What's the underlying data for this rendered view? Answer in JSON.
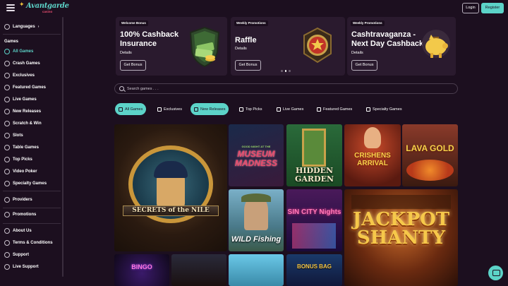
{
  "header": {
    "logo_text": "Avantgarde",
    "logo_sub": "casino",
    "login_label": "Login",
    "register_label": "Register"
  },
  "sidebar": {
    "language_label": "Languages",
    "games_heading": "Games",
    "items": [
      {
        "label": "All Games",
        "icon": "horseshoe-icon",
        "active": true
      },
      {
        "label": "Crash Games",
        "icon": "crash-icon"
      },
      {
        "label": "Exclusives",
        "icon": "exclusive-icon"
      },
      {
        "label": "Featured Games",
        "icon": "star-icon"
      },
      {
        "label": "Live Games",
        "icon": "live-icon"
      },
      {
        "label": "New Releases",
        "icon": "new-icon"
      },
      {
        "label": "Scratch & Win",
        "icon": "scratch-icon"
      },
      {
        "label": "Slots",
        "icon": "slots-icon"
      },
      {
        "label": "Table Games",
        "icon": "table-icon"
      },
      {
        "label": "Top Picks",
        "icon": "top-picks-icon"
      },
      {
        "label": "Video Poker",
        "icon": "poker-icon"
      },
      {
        "label": "Specialty Games",
        "icon": "specialty-icon"
      }
    ],
    "providers_label": "Providers",
    "promotions_label": "Promotions",
    "about_label": "About Us",
    "terms_label": "Terms & Conditions",
    "support_label": "Support",
    "live_support_label": "Live Support"
  },
  "promos": [
    {
      "badge": "Welcome Bonus",
      "title": "100% Cashback Insurance",
      "details": "Details",
      "button": "Get Bonus",
      "icon": "money-shield-icon"
    },
    {
      "badge": "Weekly Promotions",
      "title": "Raffle",
      "details": "Details",
      "button": "Get Bonus",
      "icon": "raffle-chip-icon"
    },
    {
      "badge": "Weekly Promotions",
      "title": "Cashtravaganza - Next Day Cashback",
      "details": "Details",
      "button": "Get Bonus",
      "icon": "piggy-bank-icon"
    }
  ],
  "carousel": {
    "pages": 3,
    "active": 2
  },
  "search": {
    "placeholder": "Search games . . ."
  },
  "categories": [
    {
      "label": "All Games",
      "icon": "horseshoe-icon",
      "active": true
    },
    {
      "label": "Exclusives",
      "icon": "exclusive-icon"
    },
    {
      "label": "New Releases",
      "icon": "new-icon",
      "active": true
    },
    {
      "label": "Top Picks",
      "icon": "top-picks-icon"
    },
    {
      "label": "Live Games",
      "icon": "live-icon"
    },
    {
      "label": "Featured Games",
      "icon": "star-icon"
    },
    {
      "label": "Specialty Games",
      "icon": "specialty-icon"
    }
  ],
  "games": [
    {
      "title": "SECRETS of the NILE"
    },
    {
      "title": "MUSEUM MADNESS",
      "sub": "GOOD NIGHT AT THE"
    },
    {
      "title": "HIDDEN GARDEN"
    },
    {
      "title": "CRISHENS ARRIVAL"
    },
    {
      "title": "LAVA GOLD"
    },
    {
      "title": "WILD Fishing"
    },
    {
      "title": "SIN CITY Nights"
    },
    {
      "title": "JACKPOT SHANTY"
    },
    {
      "title": "BINGO"
    },
    {
      "title": ""
    },
    {
      "title": ""
    },
    {
      "title": "BONUS BAG"
    }
  ],
  "colors": {
    "accent": "#5cd3c8",
    "background": "#1c0f1f",
    "card": "#2a1a2e"
  }
}
